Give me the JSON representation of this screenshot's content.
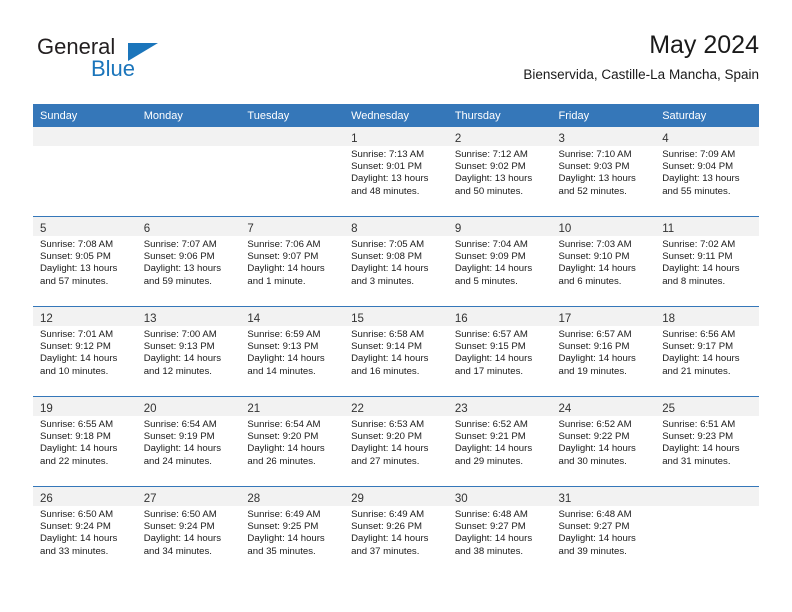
{
  "logo": {
    "line1": "General",
    "line2": "Blue",
    "triangle_color": "#1b75bb",
    "text_color": "#231f20"
  },
  "header": {
    "title": "May 2024",
    "subtitle": "Bienservida, Castille-La Mancha, Spain"
  },
  "colors": {
    "header_row_bg": "#3577b9",
    "header_row_text": "#ffffff",
    "daynum_band_bg": "#f2f2f2",
    "cell_bg": "#ffffff",
    "grid_line": "#3577b9"
  },
  "weekdays": [
    "Sunday",
    "Monday",
    "Tuesday",
    "Wednesday",
    "Thursday",
    "Friday",
    "Saturday"
  ],
  "weeks": [
    [
      {
        "day": "",
        "sunrise": "",
        "sunset": "",
        "daylight_line1": "",
        "daylight_line2": ""
      },
      {
        "day": "",
        "sunrise": "",
        "sunset": "",
        "daylight_line1": "",
        "daylight_line2": ""
      },
      {
        "day": "",
        "sunrise": "",
        "sunset": "",
        "daylight_line1": "",
        "daylight_line2": ""
      },
      {
        "day": "1",
        "sunrise": "Sunrise: 7:13 AM",
        "sunset": "Sunset: 9:01 PM",
        "daylight_line1": "Daylight: 13 hours",
        "daylight_line2": "and 48 minutes."
      },
      {
        "day": "2",
        "sunrise": "Sunrise: 7:12 AM",
        "sunset": "Sunset: 9:02 PM",
        "daylight_line1": "Daylight: 13 hours",
        "daylight_line2": "and 50 minutes."
      },
      {
        "day": "3",
        "sunrise": "Sunrise: 7:10 AM",
        "sunset": "Sunset: 9:03 PM",
        "daylight_line1": "Daylight: 13 hours",
        "daylight_line2": "and 52 minutes."
      },
      {
        "day": "4",
        "sunrise": "Sunrise: 7:09 AM",
        "sunset": "Sunset: 9:04 PM",
        "daylight_line1": "Daylight: 13 hours",
        "daylight_line2": "and 55 minutes."
      }
    ],
    [
      {
        "day": "5",
        "sunrise": "Sunrise: 7:08 AM",
        "sunset": "Sunset: 9:05 PM",
        "daylight_line1": "Daylight: 13 hours",
        "daylight_line2": "and 57 minutes."
      },
      {
        "day": "6",
        "sunrise": "Sunrise: 7:07 AM",
        "sunset": "Sunset: 9:06 PM",
        "daylight_line1": "Daylight: 13 hours",
        "daylight_line2": "and 59 minutes."
      },
      {
        "day": "7",
        "sunrise": "Sunrise: 7:06 AM",
        "sunset": "Sunset: 9:07 PM",
        "daylight_line1": "Daylight: 14 hours",
        "daylight_line2": "and 1 minute."
      },
      {
        "day": "8",
        "sunrise": "Sunrise: 7:05 AM",
        "sunset": "Sunset: 9:08 PM",
        "daylight_line1": "Daylight: 14 hours",
        "daylight_line2": "and 3 minutes."
      },
      {
        "day": "9",
        "sunrise": "Sunrise: 7:04 AM",
        "sunset": "Sunset: 9:09 PM",
        "daylight_line1": "Daylight: 14 hours",
        "daylight_line2": "and 5 minutes."
      },
      {
        "day": "10",
        "sunrise": "Sunrise: 7:03 AM",
        "sunset": "Sunset: 9:10 PM",
        "daylight_line1": "Daylight: 14 hours",
        "daylight_line2": "and 6 minutes."
      },
      {
        "day": "11",
        "sunrise": "Sunrise: 7:02 AM",
        "sunset": "Sunset: 9:11 PM",
        "daylight_line1": "Daylight: 14 hours",
        "daylight_line2": "and 8 minutes."
      }
    ],
    [
      {
        "day": "12",
        "sunrise": "Sunrise: 7:01 AM",
        "sunset": "Sunset: 9:12 PM",
        "daylight_line1": "Daylight: 14 hours",
        "daylight_line2": "and 10 minutes."
      },
      {
        "day": "13",
        "sunrise": "Sunrise: 7:00 AM",
        "sunset": "Sunset: 9:13 PM",
        "daylight_line1": "Daylight: 14 hours",
        "daylight_line2": "and 12 minutes."
      },
      {
        "day": "14",
        "sunrise": "Sunrise: 6:59 AM",
        "sunset": "Sunset: 9:13 PM",
        "daylight_line1": "Daylight: 14 hours",
        "daylight_line2": "and 14 minutes."
      },
      {
        "day": "15",
        "sunrise": "Sunrise: 6:58 AM",
        "sunset": "Sunset: 9:14 PM",
        "daylight_line1": "Daylight: 14 hours",
        "daylight_line2": "and 16 minutes."
      },
      {
        "day": "16",
        "sunrise": "Sunrise: 6:57 AM",
        "sunset": "Sunset: 9:15 PM",
        "daylight_line1": "Daylight: 14 hours",
        "daylight_line2": "and 17 minutes."
      },
      {
        "day": "17",
        "sunrise": "Sunrise: 6:57 AM",
        "sunset": "Sunset: 9:16 PM",
        "daylight_line1": "Daylight: 14 hours",
        "daylight_line2": "and 19 minutes."
      },
      {
        "day": "18",
        "sunrise": "Sunrise: 6:56 AM",
        "sunset": "Sunset: 9:17 PM",
        "daylight_line1": "Daylight: 14 hours",
        "daylight_line2": "and 21 minutes."
      }
    ],
    [
      {
        "day": "19",
        "sunrise": "Sunrise: 6:55 AM",
        "sunset": "Sunset: 9:18 PM",
        "daylight_line1": "Daylight: 14 hours",
        "daylight_line2": "and 22 minutes."
      },
      {
        "day": "20",
        "sunrise": "Sunrise: 6:54 AM",
        "sunset": "Sunset: 9:19 PM",
        "daylight_line1": "Daylight: 14 hours",
        "daylight_line2": "and 24 minutes."
      },
      {
        "day": "21",
        "sunrise": "Sunrise: 6:54 AM",
        "sunset": "Sunset: 9:20 PM",
        "daylight_line1": "Daylight: 14 hours",
        "daylight_line2": "and 26 minutes."
      },
      {
        "day": "22",
        "sunrise": "Sunrise: 6:53 AM",
        "sunset": "Sunset: 9:20 PM",
        "daylight_line1": "Daylight: 14 hours",
        "daylight_line2": "and 27 minutes."
      },
      {
        "day": "23",
        "sunrise": "Sunrise: 6:52 AM",
        "sunset": "Sunset: 9:21 PM",
        "daylight_line1": "Daylight: 14 hours",
        "daylight_line2": "and 29 minutes."
      },
      {
        "day": "24",
        "sunrise": "Sunrise: 6:52 AM",
        "sunset": "Sunset: 9:22 PM",
        "daylight_line1": "Daylight: 14 hours",
        "daylight_line2": "and 30 minutes."
      },
      {
        "day": "25",
        "sunrise": "Sunrise: 6:51 AM",
        "sunset": "Sunset: 9:23 PM",
        "daylight_line1": "Daylight: 14 hours",
        "daylight_line2": "and 31 minutes."
      }
    ],
    [
      {
        "day": "26",
        "sunrise": "Sunrise: 6:50 AM",
        "sunset": "Sunset: 9:24 PM",
        "daylight_line1": "Daylight: 14 hours",
        "daylight_line2": "and 33 minutes."
      },
      {
        "day": "27",
        "sunrise": "Sunrise: 6:50 AM",
        "sunset": "Sunset: 9:24 PM",
        "daylight_line1": "Daylight: 14 hours",
        "daylight_line2": "and 34 minutes."
      },
      {
        "day": "28",
        "sunrise": "Sunrise: 6:49 AM",
        "sunset": "Sunset: 9:25 PM",
        "daylight_line1": "Daylight: 14 hours",
        "daylight_line2": "and 35 minutes."
      },
      {
        "day": "29",
        "sunrise": "Sunrise: 6:49 AM",
        "sunset": "Sunset: 9:26 PM",
        "daylight_line1": "Daylight: 14 hours",
        "daylight_line2": "and 37 minutes."
      },
      {
        "day": "30",
        "sunrise": "Sunrise: 6:48 AM",
        "sunset": "Sunset: 9:27 PM",
        "daylight_line1": "Daylight: 14 hours",
        "daylight_line2": "and 38 minutes."
      },
      {
        "day": "31",
        "sunrise": "Sunrise: 6:48 AM",
        "sunset": "Sunset: 9:27 PM",
        "daylight_line1": "Daylight: 14 hours",
        "daylight_line2": "and 39 minutes."
      },
      {
        "day": "",
        "sunrise": "",
        "sunset": "",
        "daylight_line1": "",
        "daylight_line2": ""
      }
    ]
  ]
}
